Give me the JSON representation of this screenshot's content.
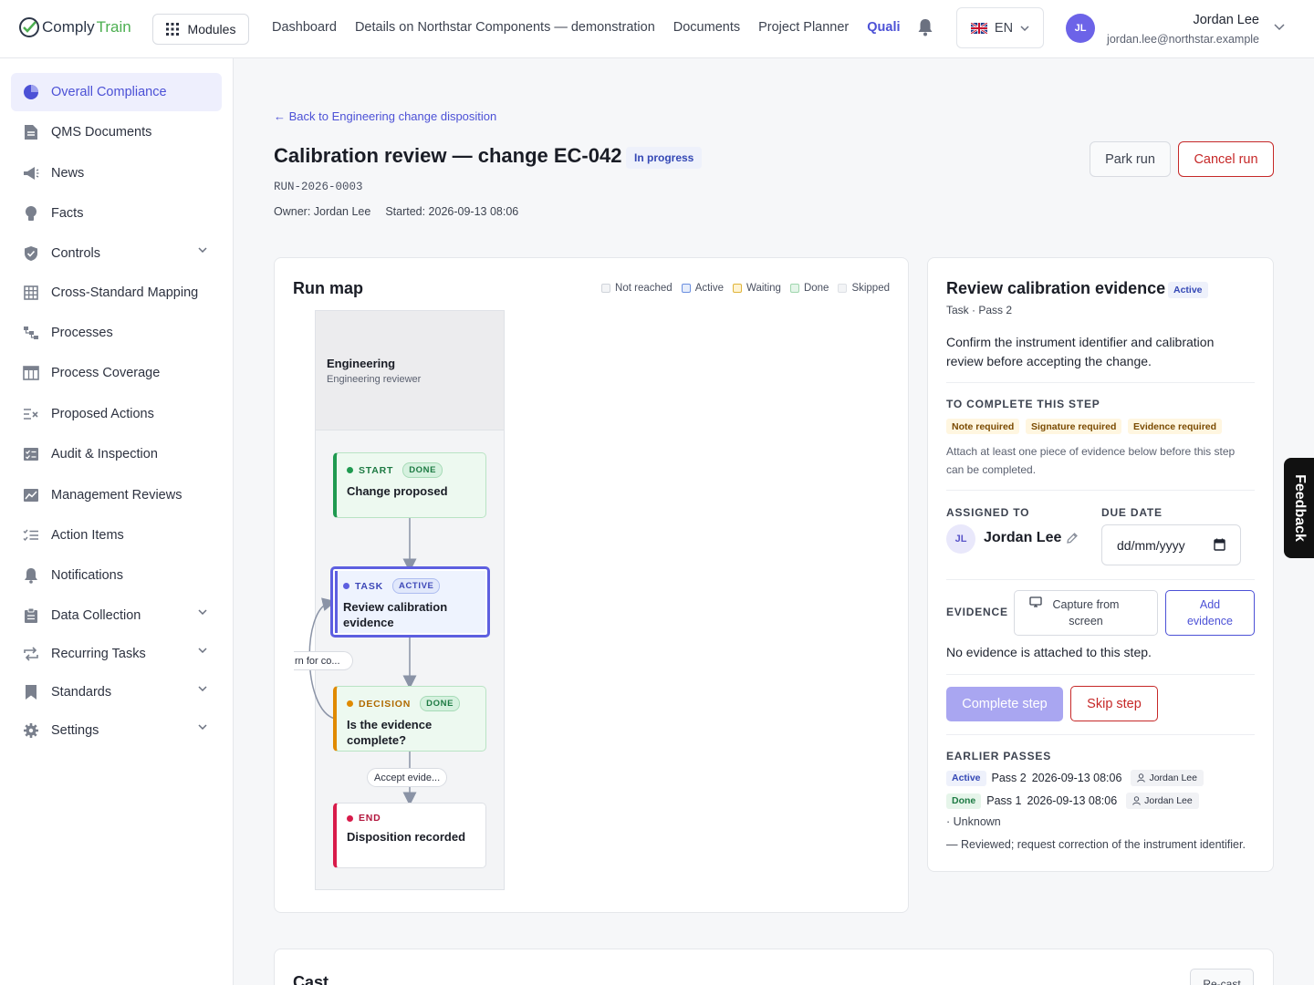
{
  "header": {
    "logo_part1": "Comply",
    "logo_part2": "Train",
    "modules_label": "Modules",
    "nav": [
      "Dashboard",
      "Details on Northstar Components — demonstration",
      "Documents",
      "Project Planner",
      "Quali"
    ],
    "lang": "EN",
    "user": {
      "initials": "JL",
      "name": "Jordan Lee",
      "email": "jordan.lee@northstar.example"
    }
  },
  "sidebar": {
    "items": [
      {
        "label": "Overall Compliance",
        "icon": "pie-chart-icon",
        "active": true
      },
      {
        "label": "QMS Documents",
        "icon": "document-icon"
      },
      {
        "label": "News",
        "icon": "megaphone-icon"
      },
      {
        "label": "Facts",
        "icon": "lightbulb-icon"
      },
      {
        "label": "Controls",
        "icon": "shield-icon",
        "expandable": true
      },
      {
        "label": "Cross-Standard Mapping",
        "icon": "grid-icon"
      },
      {
        "label": "Processes",
        "icon": "flow-icon"
      },
      {
        "label": "Process Coverage",
        "icon": "table-icon"
      },
      {
        "label": "Proposed Actions",
        "icon": "list-x-icon"
      },
      {
        "label": "Audit & Inspection",
        "icon": "checklist-icon"
      },
      {
        "label": "Management Reviews",
        "icon": "chart-box-icon"
      },
      {
        "label": "Action Items",
        "icon": "tasks-icon"
      },
      {
        "label": "Notifications",
        "icon": "bell-icon"
      },
      {
        "label": "Data Collection",
        "icon": "clipboard-icon",
        "expandable": true
      },
      {
        "label": "Recurring Tasks",
        "icon": "repeat-icon",
        "expandable": true
      },
      {
        "label": "Standards",
        "icon": "bookmark-icon",
        "expandable": true
      },
      {
        "label": "Settings",
        "icon": "gear-icon",
        "expandable": true
      }
    ]
  },
  "page": {
    "back_link": "← Back to Engineering change disposition",
    "title": "Calibration review — change EC-042",
    "status": "In progress",
    "run_id": "RUN-2026-0003",
    "owner": "Owner: Jordan Lee",
    "started": "Started: 2026-09-13 08:06",
    "park_label": "Park run",
    "cancel_label": "Cancel run"
  },
  "run_map": {
    "title": "Run map",
    "legend": [
      {
        "label": "Not reached",
        "fill": "#f3f4f6",
        "border": "#cfd3da"
      },
      {
        "label": "Active",
        "fill": "#e6edfb",
        "border": "#6b8fe0"
      },
      {
        "label": "Waiting",
        "fill": "#fff3d1",
        "border": "#e0b43a"
      },
      {
        "label": "Done",
        "fill": "#e4f5e9",
        "border": "#9fd6ad"
      },
      {
        "label": "Skipped",
        "fill": "#f3f4f6",
        "border": "#dde0e5"
      }
    ],
    "lane": {
      "title": "Engineering",
      "subtitle": "Engineering reviewer"
    },
    "nodes": [
      {
        "kind": "START",
        "status": "DONE",
        "label": "Change proposed"
      },
      {
        "kind": "TASK",
        "status": "ACTIVE",
        "label": "Review calibration evidence"
      },
      {
        "kind": "DECISION",
        "status": "DONE",
        "label": "Is the evidence complete?"
      },
      {
        "kind": "END",
        "status": "",
        "label": "Disposition recorded"
      }
    ],
    "edge_labels": {
      "return": "rn for co...",
      "accept": "Accept evide..."
    }
  },
  "step": {
    "title": "Review calibration evidence",
    "badge": "Active",
    "subtitle": "Task · Pass 2",
    "description": "Confirm the instrument identifier and calibration review before accepting the change.",
    "to_complete_heading": "TO COMPLETE THIS STEP",
    "requirements": [
      "Note required",
      "Signature required",
      "Evidence required"
    ],
    "requirement_note": "Attach at least one piece of evidence below before this step can be completed.",
    "assigned_heading": "ASSIGNED TO",
    "assignee_initials": "JL",
    "assignee_name": "Jordan Lee",
    "due_heading": "DUE DATE",
    "due_placeholder": "dd/mm/yyyy",
    "evidence_heading": "EVIDENCE",
    "capture_label": "Capture from screen",
    "add_evidence_label": "Add evidence",
    "no_evidence": "No evidence is attached to this step.",
    "complete_label": "Complete step",
    "skip_label": "Skip step",
    "earlier_heading": "EARLIER PASSES",
    "passes": [
      {
        "badge": "Active",
        "pass": "Pass 2",
        "time": "2026-09-13 08:06",
        "user": "Jordan Lee"
      },
      {
        "badge": "Done",
        "pass": "Pass 1",
        "time": "2026-09-13 08:06",
        "user": "Jordan Lee"
      }
    ],
    "pass_outcome": "· Unknown",
    "pass_comment": "— Reviewed; request correction of the instrument identifier."
  },
  "cast": {
    "title": "Cast",
    "recast_label": "Re-cast"
  },
  "feedback_label": "Feedback"
}
